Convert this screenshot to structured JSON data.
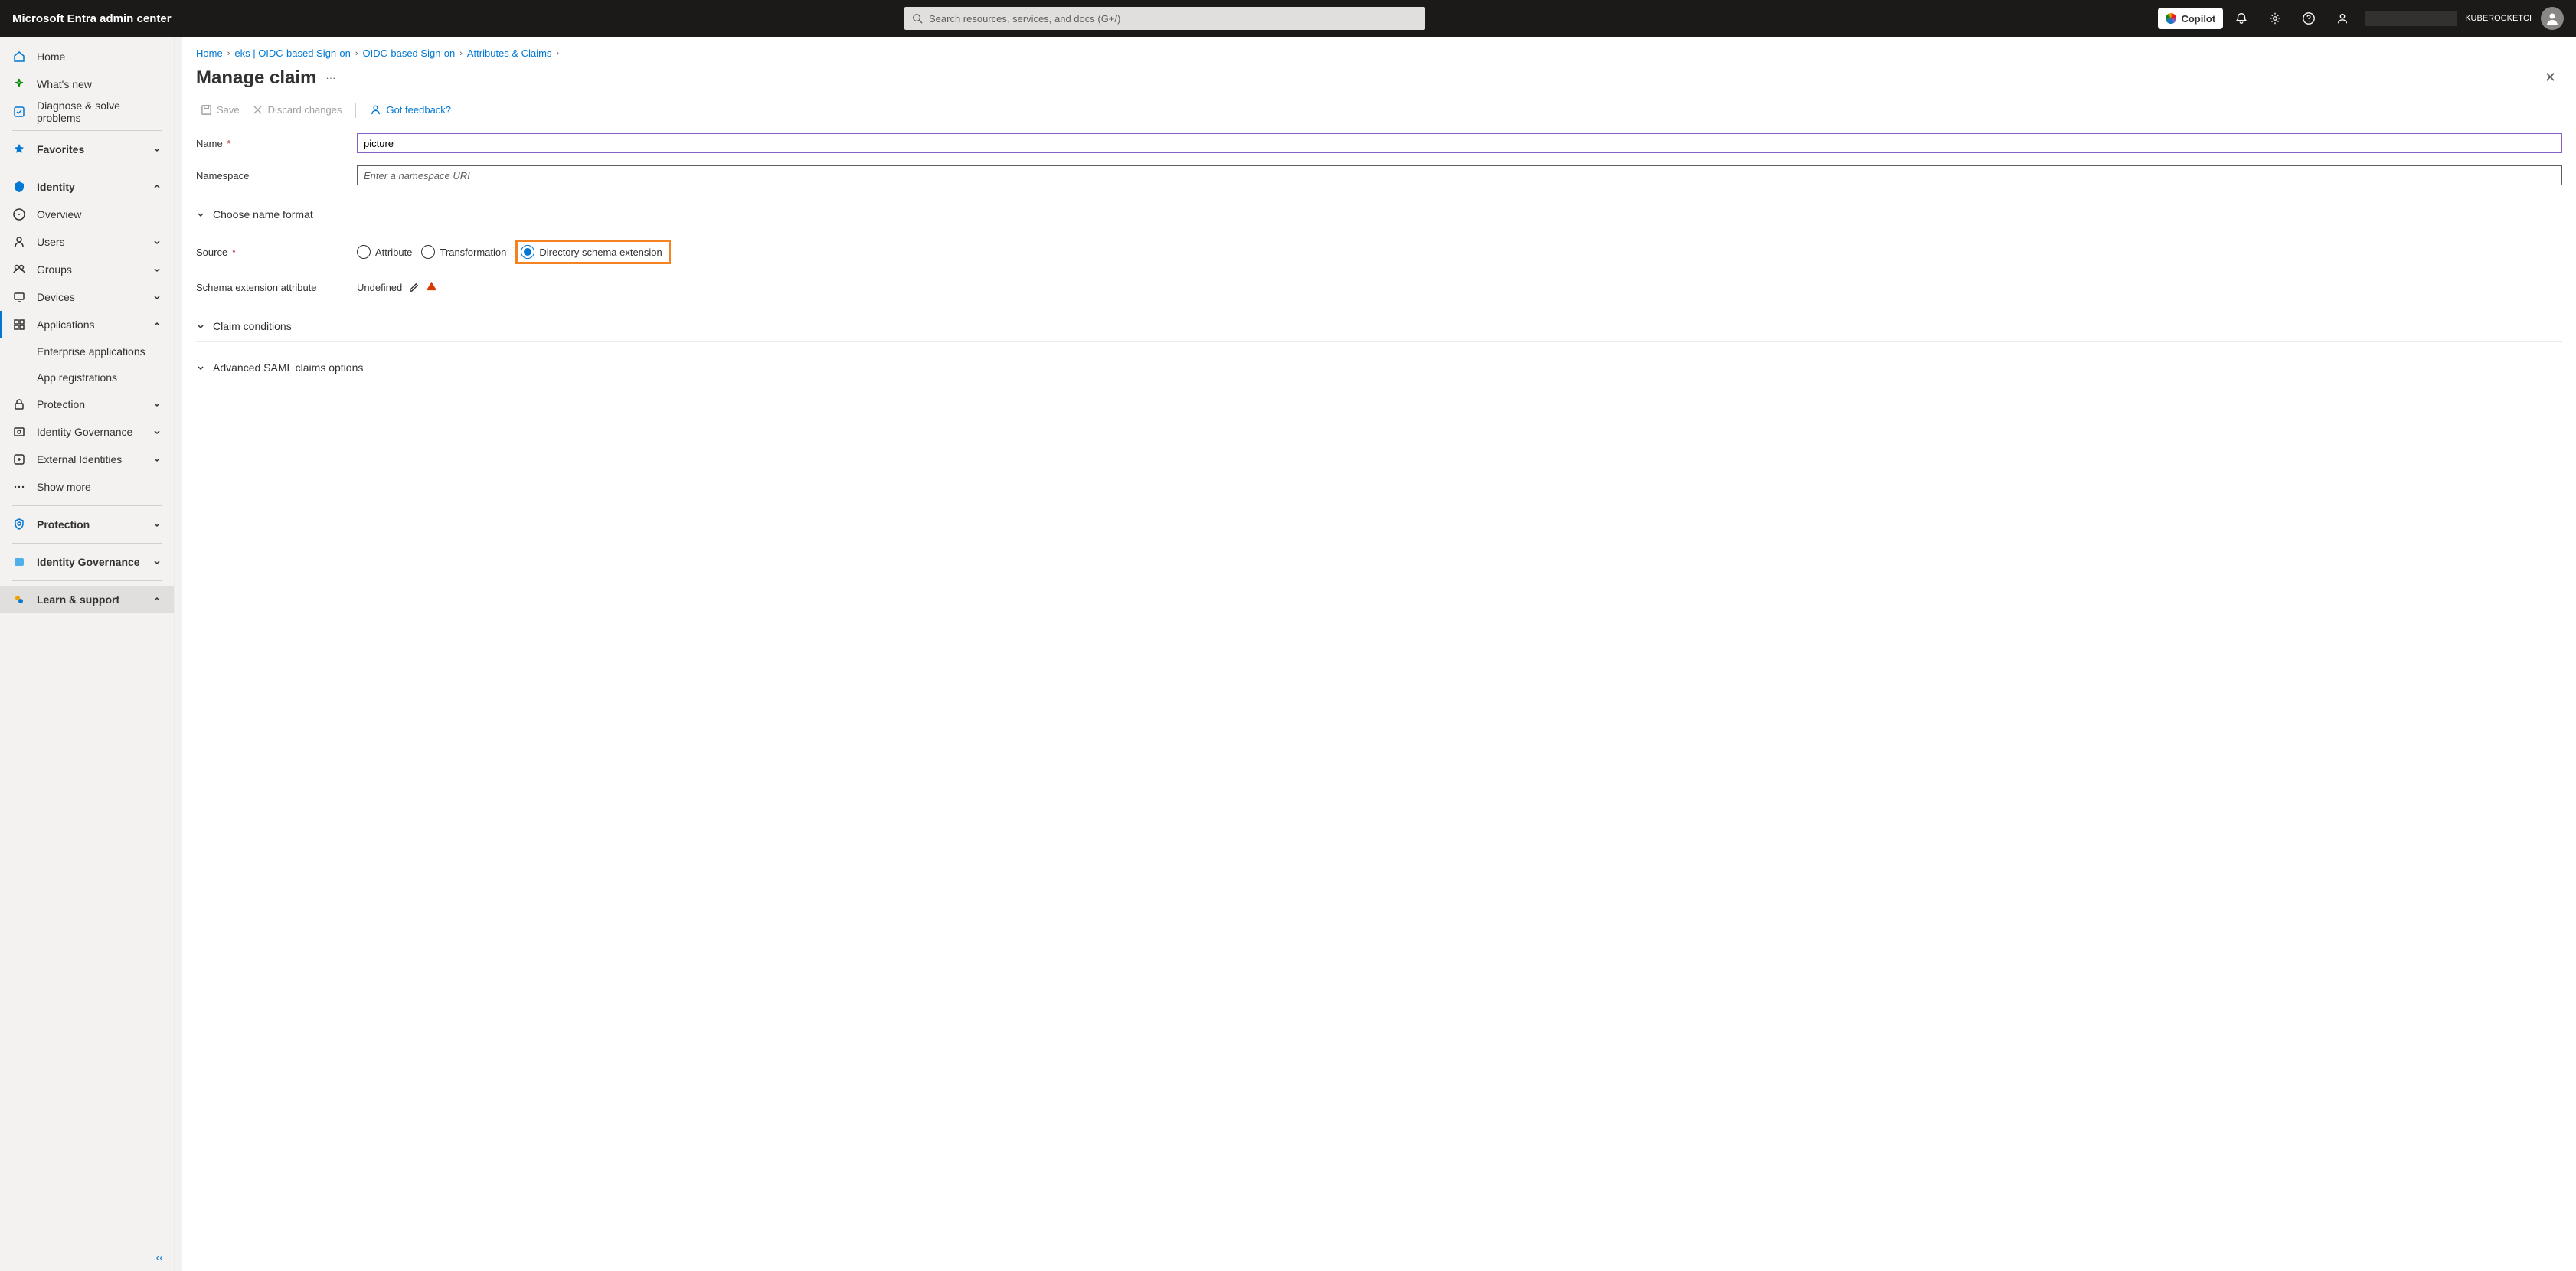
{
  "brand": "Microsoft Entra admin center",
  "search_placeholder": "Search resources, services, and docs (G+/)",
  "copilot": "Copilot",
  "tenant": "KUBEROCKETCI",
  "sidebar": {
    "home": "Home",
    "whatsnew": "What's new",
    "diagnose": "Diagnose & solve problems",
    "favorites": "Favorites",
    "identity": "Identity",
    "overview": "Overview",
    "users": "Users",
    "groups": "Groups",
    "devices": "Devices",
    "applications": "Applications",
    "ent_apps": "Enterprise applications",
    "app_reg": "App registrations",
    "protection_sub": "Protection",
    "id_gov": "Identity Governance",
    "ext_id": "External Identities",
    "showmore": "Show more",
    "protection": "Protection",
    "id_gov2": "Identity Governance",
    "learn": "Learn & support"
  },
  "crumbs": {
    "home": "Home",
    "eks": "eks | OIDC-based Sign-on",
    "oidc": "OIDC-based Sign-on",
    "attrs": "Attributes & Claims"
  },
  "page_title": "Manage claim",
  "cmdbar": {
    "save": "Save",
    "discard": "Discard changes",
    "feedback": "Got feedback?"
  },
  "form": {
    "name_label": "Name",
    "name_value": "picture",
    "ns_label": "Namespace",
    "ns_placeholder": "Enter a namespace URI",
    "choose_format": "Choose name format",
    "source_label": "Source",
    "r_attr": "Attribute",
    "r_trans": "Transformation",
    "r_dir": "Directory schema extension",
    "schema_label": "Schema extension attribute",
    "schema_val": "Undefined",
    "claim_cond": "Claim conditions",
    "adv_saml": "Advanced SAML claims options"
  }
}
